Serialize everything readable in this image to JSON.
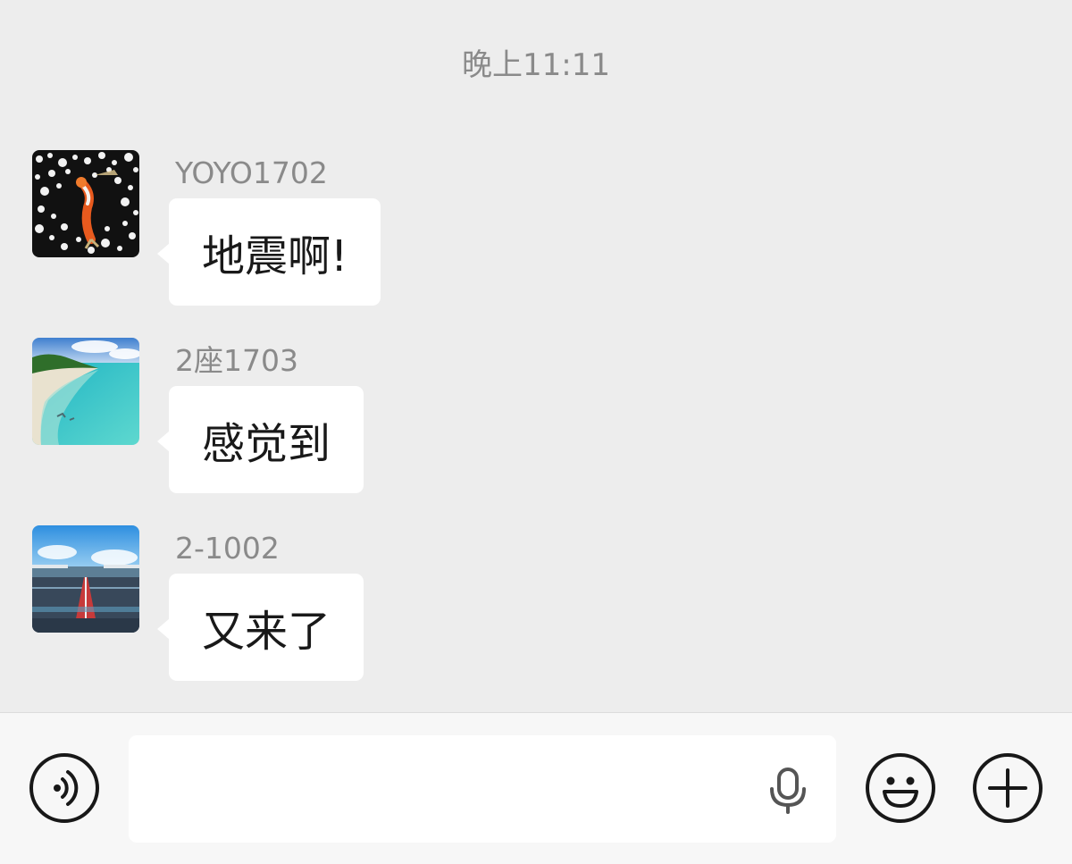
{
  "chat": {
    "timestamp": "晚上11:11",
    "messages": [
      {
        "sender": "YOYO1702",
        "text": "地震啊!",
        "avatar": "koi-fish-photo"
      },
      {
        "sender": "2座1703",
        "text": "感觉到",
        "avatar": "beach-photo"
      },
      {
        "sender": "2-1002",
        "text": "又来了",
        "avatar": "race-track-photo"
      }
    ]
  },
  "input_bar": {
    "value": "",
    "placeholder": "",
    "left_icon": "voice-icon",
    "field_icon": "microphone-icon",
    "right_icons": [
      "emoji-icon",
      "plus-icon"
    ]
  },
  "colors": {
    "background": "#ededed",
    "bubble": "#ffffff",
    "meta_text": "#8a8a8a",
    "message_text": "#191919",
    "input_bar_bg": "#f7f7f7"
  }
}
